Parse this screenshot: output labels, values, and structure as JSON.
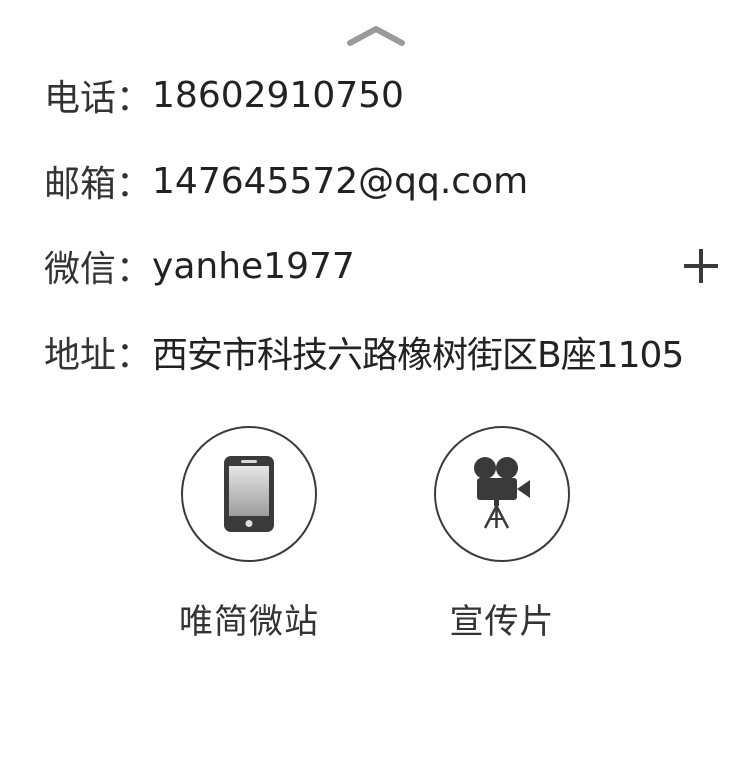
{
  "contact": {
    "phone": {
      "label": "电话：",
      "value": "18602910750"
    },
    "email": {
      "label": "邮箱：",
      "value": "147645572@qq.com"
    },
    "wechat": {
      "label": "微信：",
      "value": "yanhe1977"
    },
    "address": {
      "label": "地址：",
      "value": "西安市科技六路橡树街区B座1105"
    }
  },
  "actions": {
    "microsite": {
      "label": "唯简微站",
      "icon": "smartphone-icon"
    },
    "video": {
      "label": "宣传片",
      "icon": "film-camera-icon"
    }
  },
  "icons": {
    "collapse": "chevron-up-icon",
    "add": "plus-icon"
  },
  "colors": {
    "text": "#222222",
    "icon_dark": "#3a3a3a",
    "chevron": "#9a9a9a"
  }
}
